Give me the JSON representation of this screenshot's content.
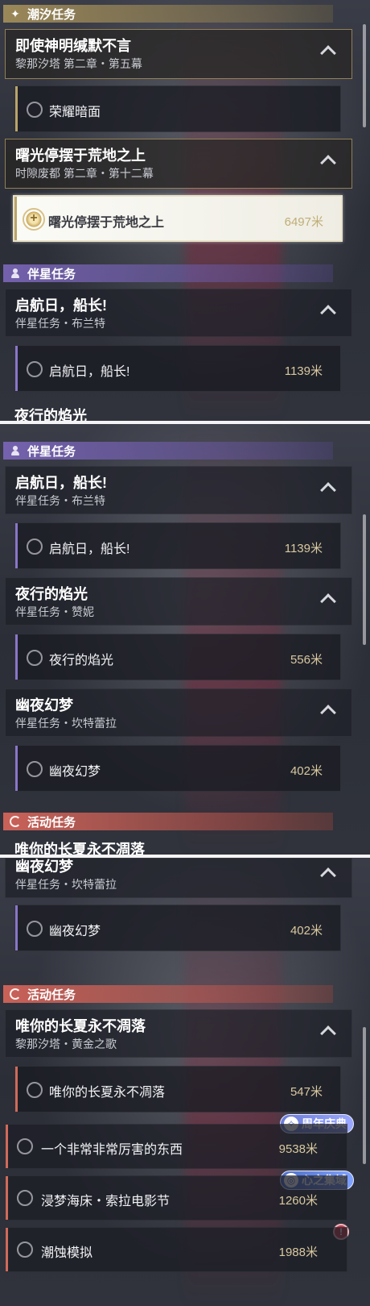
{
  "panel1": {
    "sections": {
      "tide": {
        "label": "潮汐任务"
      },
      "companion": {
        "label": "伴星任务"
      }
    },
    "quests": [
      {
        "title": "即使神明缄默不言",
        "subtitle": "黎那汐塔 第二章・第五幕"
      },
      {
        "title": "曙光停摆于荒地之上",
        "subtitle": "时隙废都 第二章・第十二幕"
      },
      {
        "title": "启航日，船长!",
        "subtitle": "伴星任务・布兰特"
      }
    ],
    "subs": [
      {
        "title": "荣耀暗面",
        "distance": ""
      },
      {
        "title": "曙光停摆于荒地之上",
        "distance": "6497米"
      },
      {
        "title": "启航日，船长!",
        "distance": "1139米"
      }
    ],
    "cut_title": "夜行的焰光"
  },
  "panel2": {
    "sections": {
      "companion": {
        "label": "伴星任务"
      },
      "event": {
        "label": "活动任务"
      }
    },
    "quests": [
      {
        "title": "启航日，船长!",
        "subtitle": "伴星任务・布兰特"
      },
      {
        "title": "夜行的焰光",
        "subtitle": "伴星任务・赞妮"
      },
      {
        "title": "幽夜幻梦",
        "subtitle": "伴星任务・坎特蕾拉"
      }
    ],
    "subs": [
      {
        "title": "启航日，船长!",
        "distance": "1139米"
      },
      {
        "title": "夜行的焰光",
        "distance": "556米"
      },
      {
        "title": "幽夜幻梦",
        "distance": "402米"
      }
    ],
    "cut_title": "唯你的长夏永不凋落"
  },
  "panel3": {
    "cut_quest": {
      "title": "幽夜幻梦",
      "subtitle": "伴星任务・坎特蕾拉"
    },
    "sub_top": {
      "title": "幽夜幻梦",
      "distance": "402米"
    },
    "sections": {
      "event": {
        "label": "活动任务"
      }
    },
    "quest": {
      "title": "唯你的长夏永不凋落",
      "subtitle": "黎那汐塔・黄金之歌"
    },
    "sub": {
      "title": "唯你的长夏永不凋落",
      "distance": "547米"
    },
    "events": [
      {
        "title": "一个非常非常厉害的东西",
        "distance": "9538米"
      },
      {
        "title": "浸梦海床・索拉电影节",
        "distance": "1260米"
      },
      {
        "title": "潮蚀模拟",
        "distance": "1988米"
      }
    ],
    "badges": {
      "anniversary": "周年庆典",
      "heart": "心之集域"
    }
  },
  "colors": {
    "tide": "#b9a46a",
    "companion": "#8a76c9",
    "event": "#d06a5a",
    "distance": "#d9c9a0"
  }
}
